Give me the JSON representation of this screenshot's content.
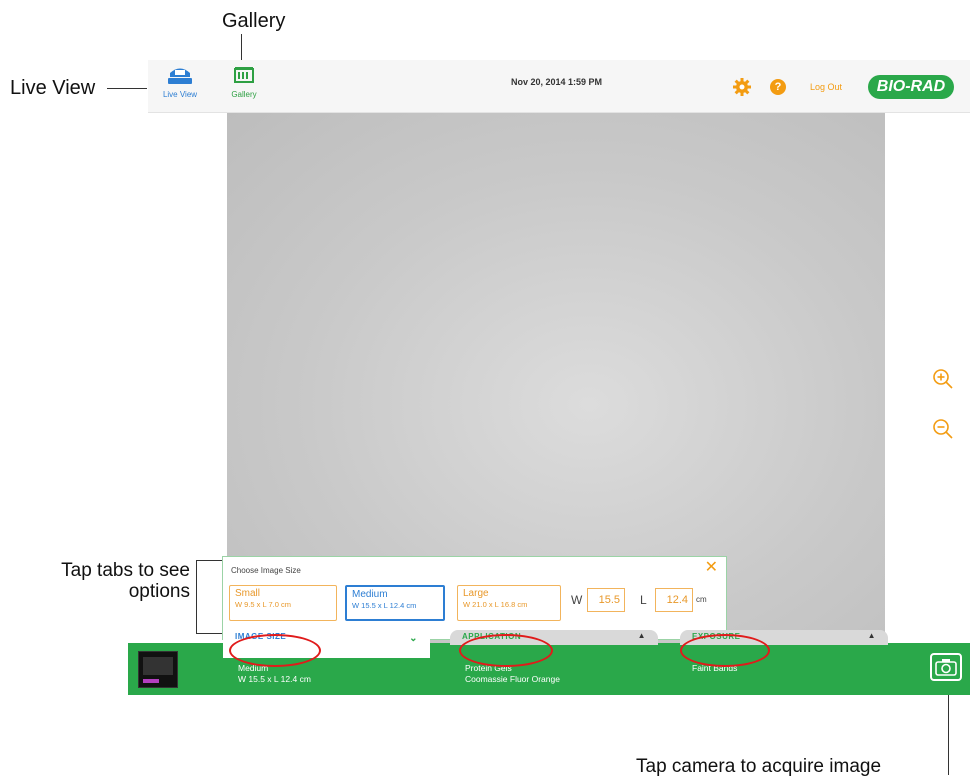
{
  "callouts": {
    "gallery": "Gallery",
    "live_view": "Live View",
    "tap_tabs": "Tap tabs to see options",
    "tap_camera": "Tap camera to acquire image"
  },
  "topbar": {
    "nav": [
      {
        "label": "Live View",
        "icon": "live-view-icon",
        "color": "#2d7ed3"
      },
      {
        "label": "Gallery",
        "icon": "gallery-icon",
        "color": "#2ea043"
      }
    ],
    "datetime": "Nov 20, 2014   1:59 PM",
    "help_glyph": "?",
    "logout": "Log Out",
    "logo": "BIO-RAD"
  },
  "image_size_panel": {
    "title": "Choose Image Size",
    "close_glyph": "✕",
    "options": [
      {
        "name": "Small",
        "dims": "W 9.5 x L 7.0 cm",
        "selected": false
      },
      {
        "name": "Medium",
        "dims": "W 15.5 x L 12.4 cm",
        "selected": true
      },
      {
        "name": "Large",
        "dims": "W 21.0 x L 16.8 cm",
        "selected": false
      }
    ],
    "w_label": "W",
    "w_value": "15.5",
    "l_label": "L",
    "l_value": "12.4",
    "unit": "cm"
  },
  "tabs": [
    {
      "label": "IMAGE SIZE",
      "caret": "⌄",
      "value_line1": "Medium",
      "value_line2": "W 15.5 x L 12.4 cm"
    },
    {
      "label": "APPLICATION",
      "caret": "▲",
      "value_line1": "Protein Gels",
      "value_line2": "Coomassie Fluor Orange"
    },
    {
      "label": "EXPOSURE",
      "caret": "▲",
      "value_line1": "Faint Bands",
      "value_line2": ""
    }
  ],
  "colors": {
    "brand_green": "#2aa84a",
    "accent_blue": "#2d7ed3",
    "accent_orange": "#f39c12",
    "highlight_red": "#e01b1b"
  }
}
